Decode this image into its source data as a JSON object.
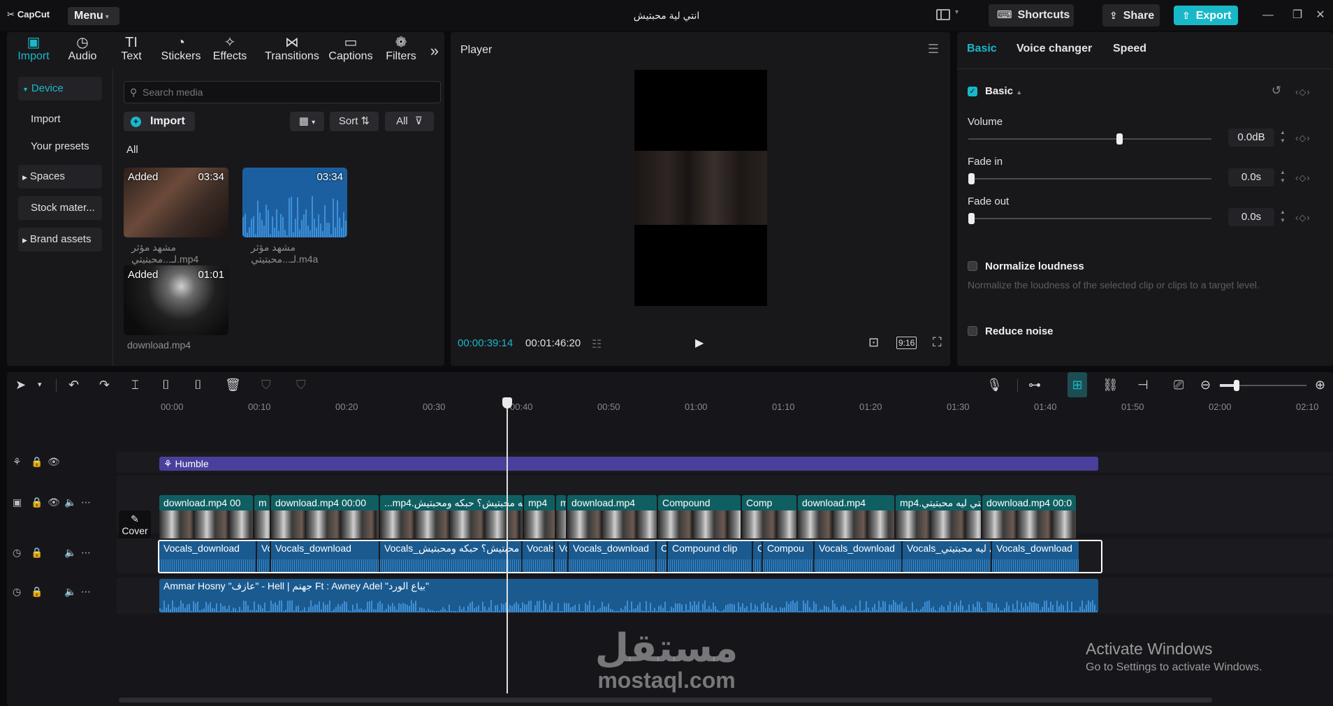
{
  "app": {
    "logo": "CapCut",
    "menu": "Menu",
    "title": "انتي لية محبتيش"
  },
  "titlebar": {
    "shortcuts": "Shortcuts",
    "share": "Share",
    "export": "Export"
  },
  "media_tabs": [
    {
      "label": "Import",
      "icon": "import-icon",
      "glyph": "▣"
    },
    {
      "label": "Audio",
      "icon": "audio-icon",
      "glyph": "◷"
    },
    {
      "label": "Text",
      "icon": "text-icon",
      "glyph": "TI"
    },
    {
      "label": "Stickers",
      "icon": "stickers-icon",
      "glyph": "◔"
    },
    {
      "label": "Effects",
      "icon": "effects-icon",
      "glyph": "✧"
    },
    {
      "label": "Transitions",
      "icon": "transitions-icon",
      "glyph": "⋈"
    },
    {
      "label": "Captions",
      "icon": "captions-icon",
      "glyph": "▭"
    },
    {
      "label": "Filters",
      "icon": "filters-icon",
      "glyph": "❁"
    }
  ],
  "media_sidebar": {
    "device": "Device",
    "import": "Import",
    "presets": "Your presets",
    "spaces": "Spaces",
    "stock": "Stock mater...",
    "brand": "Brand assets"
  },
  "media": {
    "search_placeholder": "Search media",
    "import_label": "Import",
    "sort_label": "Sort",
    "all_filter": "All",
    "section_label": "All",
    "items": [
      {
        "tag": "Added",
        "duration": "03:34",
        "name": "مشهد مؤثر لـ...محبتيتي.mp4"
      },
      {
        "tag": "",
        "duration": "03:34",
        "name": "مشهد مؤثر لـ...محبتيتي.m4a"
      },
      {
        "tag": "Added",
        "duration": "01:01",
        "name": "download.mp4"
      }
    ]
  },
  "player": {
    "title": "Player",
    "current_time": "00:00:39:14",
    "total_time": "00:01:46:20",
    "ratio": "9:16"
  },
  "props": {
    "tabs": [
      "Basic",
      "Voice changer",
      "Speed"
    ],
    "section": "Basic",
    "volume": {
      "label": "Volume",
      "value": "0.0dB",
      "level": 0.61
    },
    "fade_in": {
      "label": "Fade in",
      "value": "0.0s",
      "level": 0.0
    },
    "fade_out": {
      "label": "Fade out",
      "value": "0.0s",
      "level": 0.0
    },
    "normalize": {
      "label": "Normalize loudness",
      "desc": "Normalize the loudness of the selected clip or clips to a target level."
    },
    "noise": {
      "label": "Reduce noise"
    }
  },
  "timeline": {
    "ruler": [
      "00:00",
      "00:10",
      "00:20",
      "00:30",
      "00:40",
      "00:50",
      "01:00",
      "01:10",
      "01:20",
      "01:30",
      "01:40",
      "01:50",
      "02:00",
      "02:10"
    ],
    "cover_label": "Cover",
    "effect_track": "Humble",
    "video_clips": [
      "download.mp4",
      "00",
      "m",
      "download.mp4",
      "00:00",
      "...mp4.إنتي ليه محبتيش؟ حبكه ومحبتيش",
      "mp4",
      "m",
      "download.mp4",
      "Compound",
      "Comp",
      "download.mp4",
      "mp4.إنتي ليه محبتيتي",
      "download.mp4",
      "00:0"
    ],
    "audio_clips": [
      "Vocals_download",
      "Vo",
      "Vocals_download",
      "Vocals_إنتي ليه محبتيش؟ حبكه ومحبتيش",
      "Vocals",
      "Vo",
      "Vocals_download",
      "C",
      "Compound clip",
      "C",
      "Compou",
      "Vocals_download",
      "Vocals_إنتي ليه محبتيتي",
      "Vocals_download"
    ],
    "music_clip": "Ammar Hosny \"عازف\" - Hell | جهنم Ft : Awney Adel \"بياع الورد\""
  },
  "overlay": {
    "watermark_ar": "مستقل",
    "watermark_en": "mostaql.com",
    "activate_title": "Activate Windows",
    "activate_sub": "Go to Settings to activate Windows."
  },
  "colors": {
    "accent": "#19b8c9",
    "video_track": "#0f5f62",
    "audio_track": "#1a5a8f",
    "effect_track": "#4b3f9c"
  }
}
